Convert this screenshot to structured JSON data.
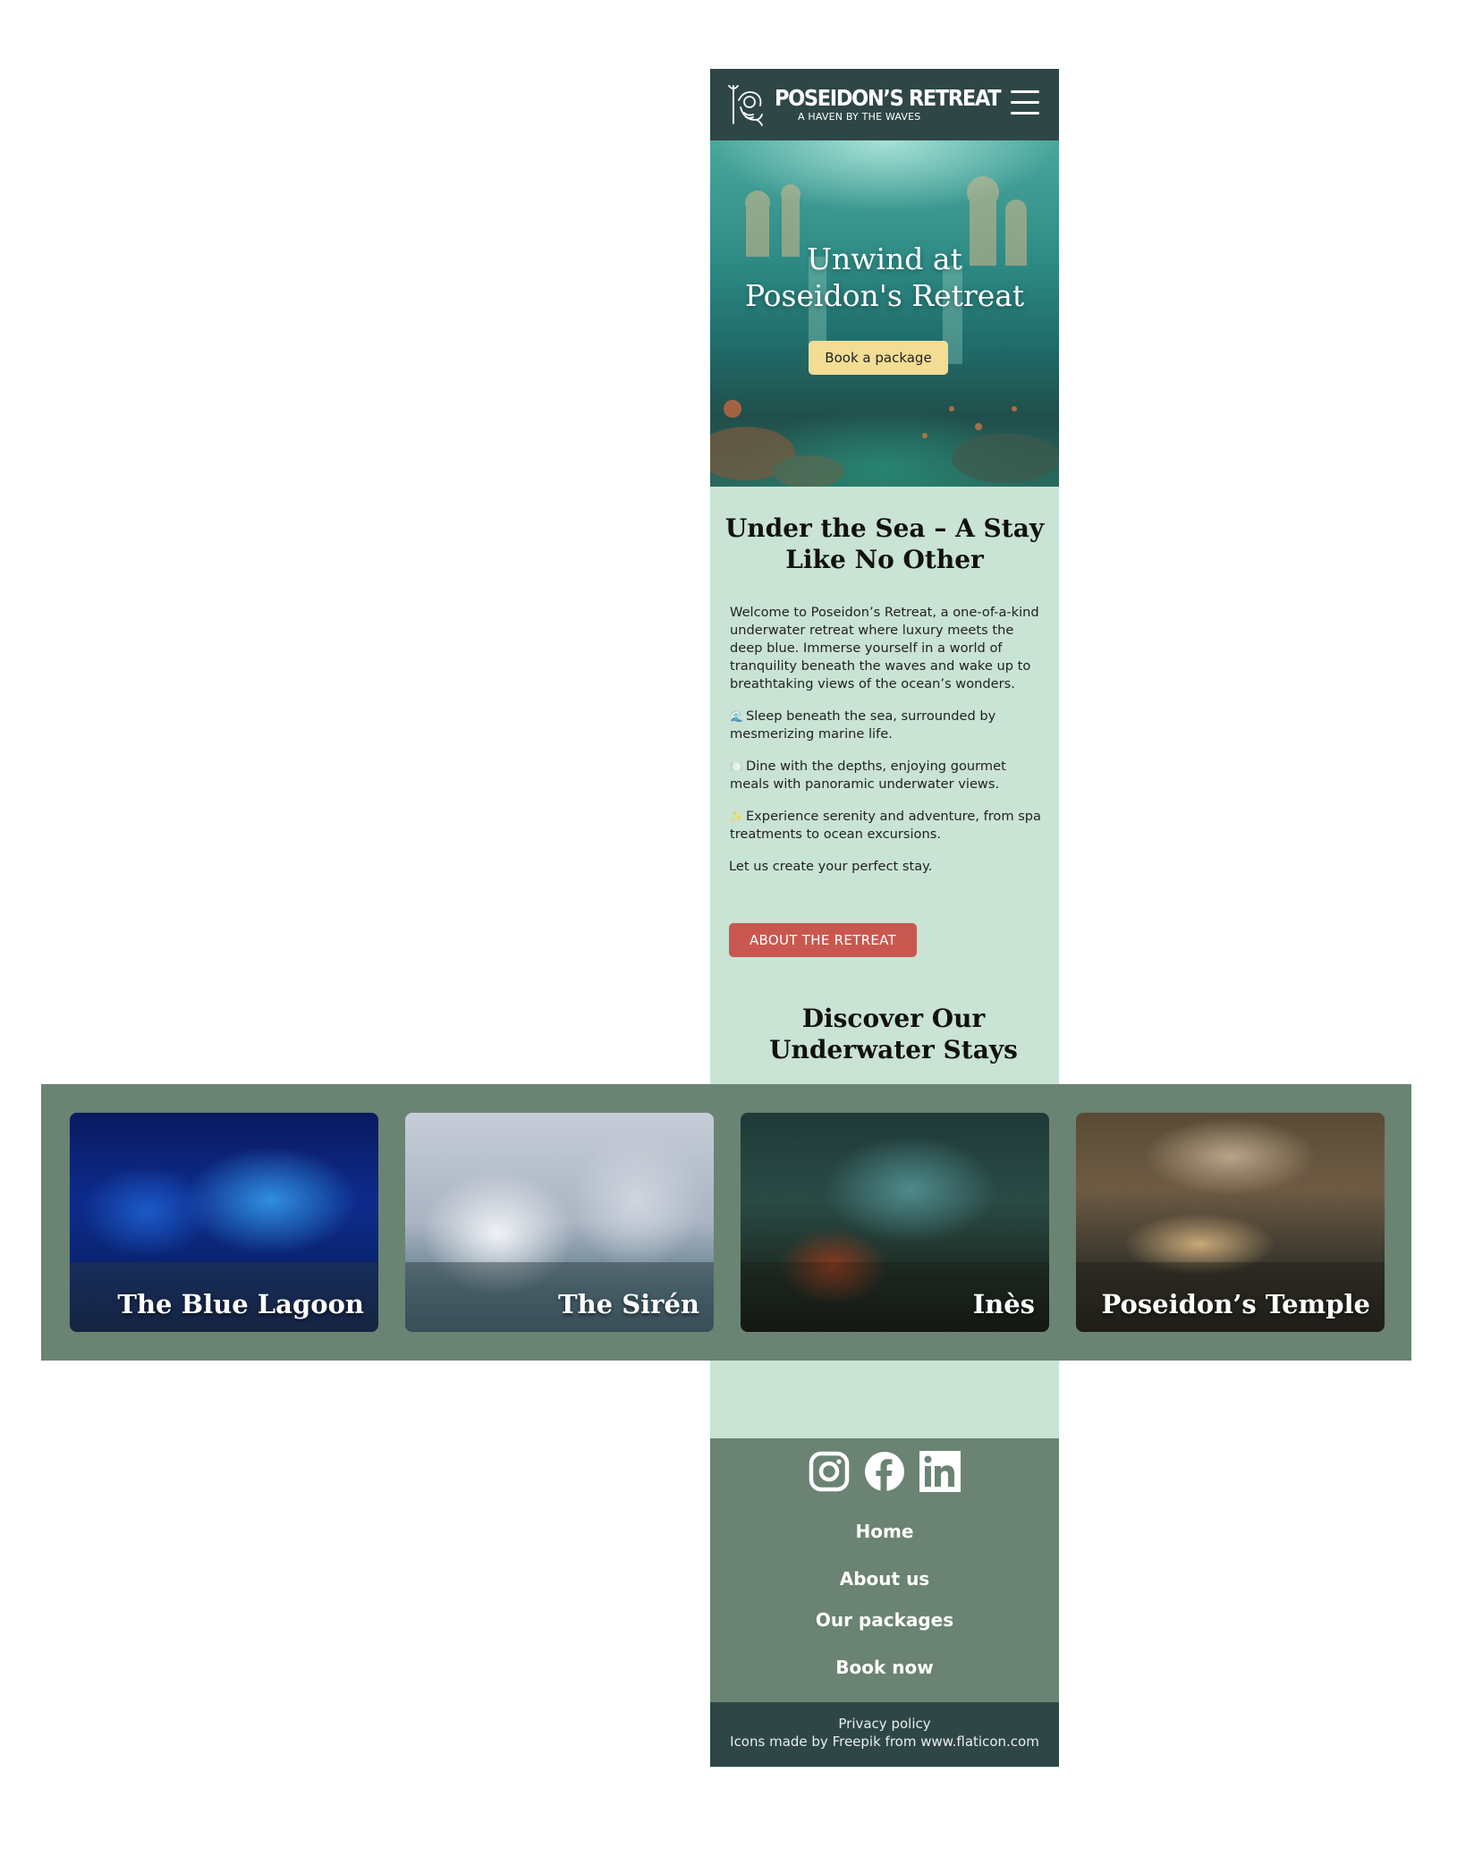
{
  "header": {
    "brand": "POSEIDON’S RETREAT",
    "tagline": "A HAVEN BY THE WAVES",
    "logo_icon": "poseidon-logo-icon",
    "menu_icon": "hamburger-menu-icon"
  },
  "hero": {
    "title_line1": "Unwind at",
    "title_line2": "Poseidon's Retreat",
    "button": "Book a package"
  },
  "intro": {
    "title_line1": "Under the Sea – A Stay",
    "title_line2": "Like No Other",
    "paragraph": "Welcome to Poseidon’s Retreat, a one-of-a-kind underwater retreat where luxury meets the deep blue. Immerse yourself in a world of tranquility beneath the waves and wake up to breathtaking views of the ocean’s wonders.",
    "features": [
      {
        "emoji": "🌊",
        "text": "Sleep beneath the sea, surrounded by mesmerizing marine life."
      },
      {
        "emoji": "🍽️",
        "text": "Dine with the depths, enjoying gourmet meals with panoramic underwater views."
      },
      {
        "emoji": "✨",
        "text": "Experience serenity and adventure, from spa treatments to ocean excursions."
      }
    ],
    "closing": "Let us create your perfect stay.",
    "button": "ABOUT THE RETREAT"
  },
  "stays": {
    "title_line1": "Discover Our",
    "title_line2": "Underwater Stays",
    "cards": [
      {
        "name": "The Blue Lagoon"
      },
      {
        "name": "The Sirén"
      },
      {
        "name": "Inès"
      },
      {
        "name": "Poseidon’s Temple"
      }
    ]
  },
  "footer": {
    "socials": [
      "instagram-icon",
      "facebook-icon",
      "linkedin-icon"
    ],
    "nav": [
      "Home",
      "About us",
      "Our packages",
      "Book now"
    ],
    "privacy": "Privacy policy",
    "credits": "Icons made by Freepik from www.flaticon.com"
  },
  "colors": {
    "header_bg": "#2f4646",
    "page_bg": "#c9e3d4",
    "band_bg": "#6a8373",
    "hero_button": "#f3dd94",
    "accent_button": "#c8584f"
  }
}
